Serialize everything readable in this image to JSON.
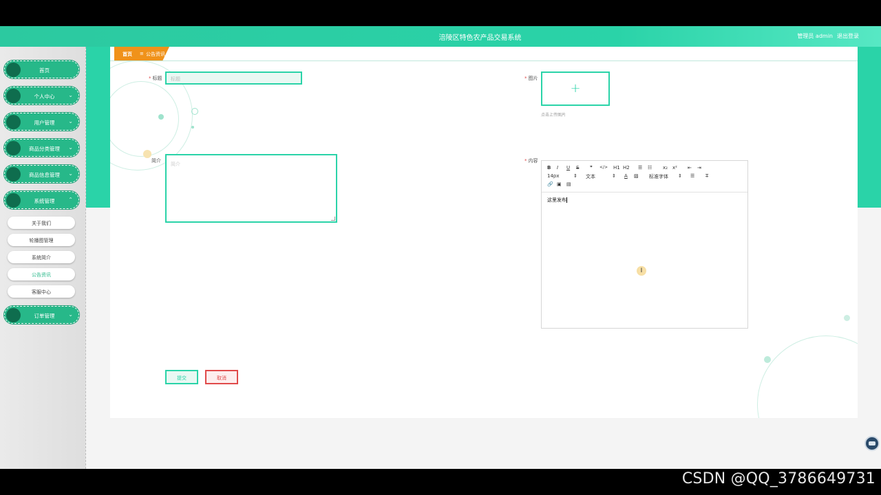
{
  "header": {
    "title": "涪陵区特色农产品交易系统",
    "user": "管理员 admin",
    "logout": "退出登录"
  },
  "sidebar": {
    "items": [
      {
        "label": "首页",
        "chevron": ""
      },
      {
        "label": "个人中心",
        "chevron": "⌄"
      },
      {
        "label": "用户管理",
        "chevron": "⌄"
      },
      {
        "label": "商品分类管理",
        "chevron": "⌄"
      },
      {
        "label": "商品信息管理",
        "chevron": "⌄"
      },
      {
        "label": "系统管理",
        "chevron": "⌃"
      },
      {
        "label": "订单管理",
        "chevron": "⌄"
      }
    ],
    "subitems": [
      {
        "label": "关于我们"
      },
      {
        "label": "轮播图管理"
      },
      {
        "label": "系统简介"
      },
      {
        "label": "公告资讯"
      },
      {
        "label": "客服中心"
      }
    ]
  },
  "breadcrumb": {
    "home": "首页",
    "separator": "≡",
    "current": "公告资讯"
  },
  "form": {
    "title_label": "标题",
    "title_placeholder": "标题",
    "image_label": "图片",
    "upload_plus": "+",
    "upload_hint": "点击上传图片",
    "intro_label": "简介",
    "intro_placeholder": "简介",
    "content_label": "内容",
    "content_text": "这里发布",
    "submit": "提交",
    "cancel": "取消"
  },
  "editor_toolbar": {
    "row1": [
      "B",
      "I",
      "U",
      "S",
      "❞",
      "</>",
      "H1",
      "H2",
      "☰",
      "☷",
      "x₂",
      "x²",
      "⇤",
      "⇥"
    ],
    "font_size": "14px",
    "text_style": "文本",
    "font_family": "标准字体",
    "row3": [
      "🔗",
      "▣",
      "▤"
    ]
  },
  "watermark": "CSDN @QQ_3786649731",
  "colors": {
    "primary": "#2ad3a8",
    "accent": "#f0921a",
    "danger": "#e04a4a"
  }
}
